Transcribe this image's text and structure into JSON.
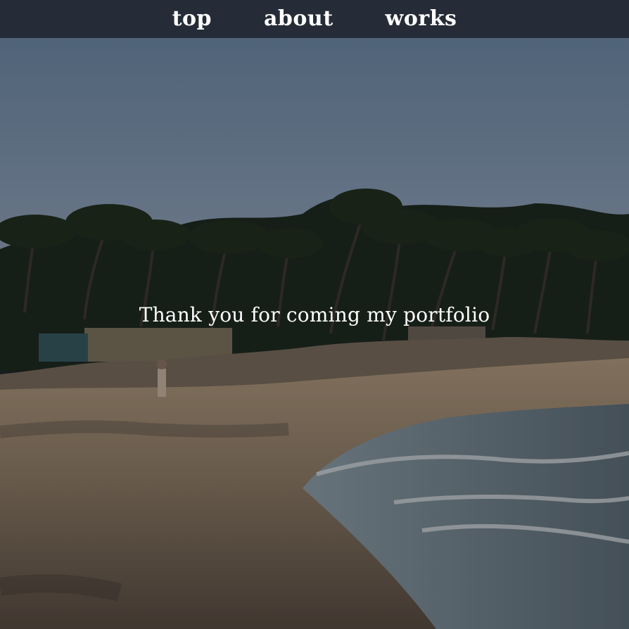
{
  "nav": {
    "items": [
      {
        "label": "top"
      },
      {
        "label": "about"
      },
      {
        "label": "works"
      }
    ]
  },
  "hero": {
    "message": "Thank you for coming my portfolio"
  }
}
